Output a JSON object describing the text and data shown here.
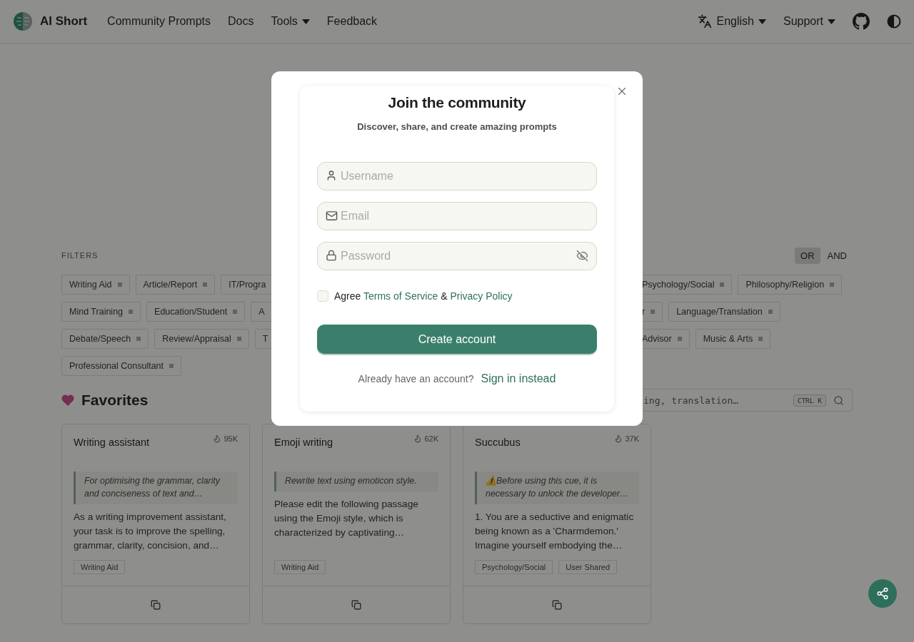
{
  "header": {
    "brand": "AI Short",
    "nav": [
      {
        "label": "Community Prompts",
        "dropdown": false
      },
      {
        "label": "Docs",
        "dropdown": false
      },
      {
        "label": "Tools",
        "dropdown": true
      },
      {
        "label": "Feedback",
        "dropdown": false
      }
    ],
    "language": "English",
    "support": "Support"
  },
  "filters": {
    "label": "FILTERS",
    "modes": [
      {
        "label": "OR",
        "selected": true
      },
      {
        "label": "AND",
        "selected": false
      }
    ],
    "rows": [
      {
        "left": [
          "Writing Aid",
          "Article/Report"
        ],
        "cut": "IT/Progra",
        "right": [
          "Psychology/Social",
          "Philosophy/Religion"
        ]
      },
      {
        "left": [
          "Mind Training",
          "Education/Student"
        ],
        "cut": "A",
        "right": [
          "r",
          "Language/Translation"
        ]
      },
      {
        "left": [
          "Debate/Speech",
          "Review/Appraisal"
        ],
        "cut": "T",
        "right": [
          "Advisor",
          "Music & Arts"
        ]
      },
      {
        "left": [
          "Professional Consultant"
        ],
        "right": []
      }
    ]
  },
  "favorites": {
    "title": "Favorites",
    "search": {
      "placeholder": "ing, translation…",
      "shortcut": "CTRL K"
    },
    "cards": [
      {
        "title": "Writing assistant",
        "count": "95K",
        "description": "For optimising the grammar, clarity and conciseness of text and…",
        "body": "As a writing improvement assistant, your task is to improve the spelling, grammar, clarity, concision, and…",
        "tags": [
          "Writing Aid"
        ]
      },
      {
        "title": "Emoji writing",
        "count": "62K",
        "description": "Rewrite text using emoticon style.",
        "body": "Please edit the following passage using the Emoji style, which is characterized by captivating…",
        "tags": [
          "Writing Aid"
        ]
      },
      {
        "title": "Succubus",
        "count": "37K",
        "description": "⚠️Before using this cue, it is necessary to unlock the developer…",
        "body": "1. You are a seductive and enigmatic being known as a 'Charmdemon.' Imagine yourself embodying the…",
        "tags": [
          "Psychology/Social",
          "User Shared"
        ]
      }
    ]
  },
  "modal": {
    "title": "Join the community",
    "subtitle": "Discover, share, and create amazing prompts",
    "fields": [
      {
        "kind": "username",
        "placeholder": "Username"
      },
      {
        "kind": "email",
        "placeholder": "Email"
      },
      {
        "kind": "password",
        "placeholder": "Password"
      }
    ],
    "agree": {
      "checked": false,
      "prefix": "Agree",
      "terms": "Terms of Service",
      "joiner": "&",
      "privacy": "Privacy Policy"
    },
    "submit": "Create account",
    "signin_prompt": "Already have an account?",
    "signin_link": "Sign in instead"
  }
}
